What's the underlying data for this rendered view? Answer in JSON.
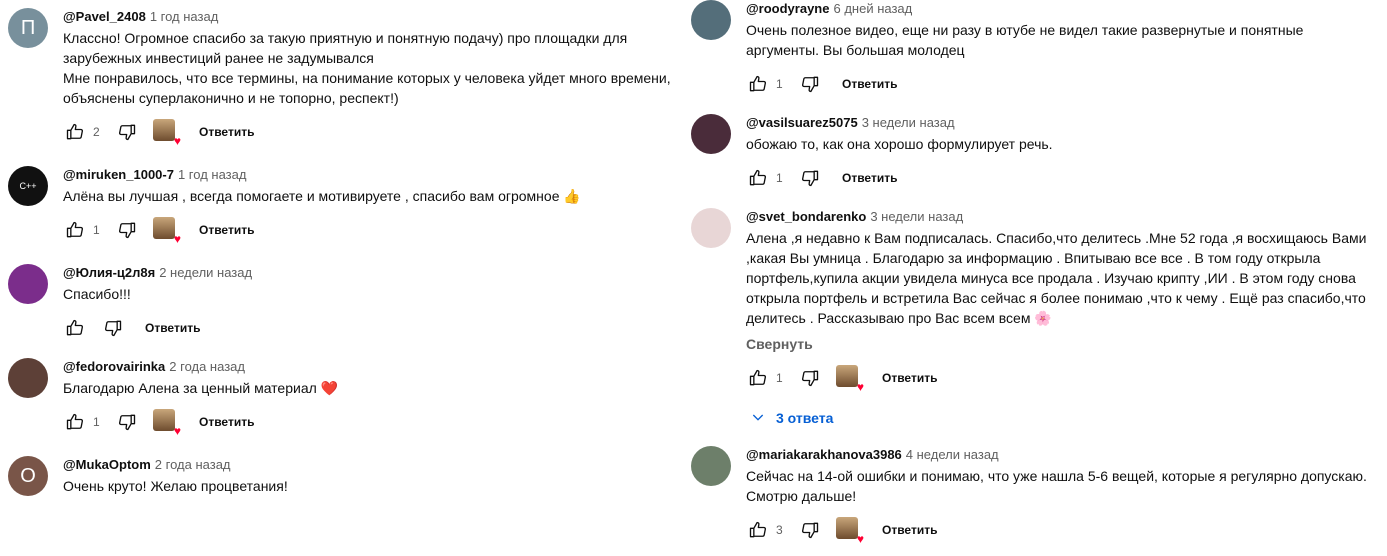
{
  "left": [
    {
      "author": "@Pavel_2408",
      "time": "1 год назад",
      "avatar_letter": "П",
      "avatar_color": "#78909c",
      "text": [
        "Классно! Огромное спасибо за такую приятную и понятную подачу) про площадки для",
        "зарубежных инвестиций ранее не задумывался",
        "Мне понравилось, что все термины, на понимание которых у человека уйдет много времени,",
        "объяснены суперлаконично и не топорно, респект!)"
      ],
      "likes": "2",
      "reply_label": "Ответить",
      "hearted": true
    },
    {
      "author": "@miruken_1000-7",
      "time": "1 год назад",
      "avatar_letter": "C++",
      "avatar_color": "#111111",
      "text": [
        "Алёна  вы лучшая , всегда помогаете и мотивируете , спасибо вам огромное"
      ],
      "emoji": "👍",
      "likes": "1",
      "reply_label": "Ответить",
      "hearted": true
    },
    {
      "author": "@Юлия-ц2л8я",
      "time": "2 недели назад",
      "avatar_color": "#7b2d8b",
      "text": [
        "Спасибо!!!"
      ],
      "likes": "",
      "reply_label": "Ответить",
      "hearted": false
    },
    {
      "author": "@fedorovairinka",
      "time": "2 года назад",
      "avatar_color": "#5d4037",
      "text": [
        "Благодарю Алена за ценный материал"
      ],
      "emoji": "❤️",
      "likes": "1",
      "reply_label": "Ответить",
      "hearted": true
    },
    {
      "author": "@MukaOptom",
      "time": "2 года назад",
      "avatar_letter": "О",
      "avatar_color": "#795548",
      "text": [
        "Очень круто! Желаю процветания!"
      ]
    }
  ],
  "right": [
    {
      "author": "@roodyrayne",
      "time": "6 дней назад",
      "avatar_color": "#546e7a",
      "text": [
        "Очень полезное видео, еще ни разу в ютубе не видел такие развернутые и понятные",
        "аргументы. Вы большая молодец"
      ],
      "likes": "1",
      "reply_label": "Ответить",
      "hearted": false
    },
    {
      "author": "@vasilsuarez5075",
      "time": "3 недели назад",
      "avatar_color": "#4a2c3a",
      "text": [
        "обожаю то, как она хорошо формулирует речь."
      ],
      "likes": "1",
      "reply_label": "Ответить",
      "hearted": false
    },
    {
      "author": "@svet_bondarenko",
      "time": "3 недели назад",
      "avatar_color": "#e8d6d6",
      "text": [
        "Алена ,я недавно к Вам подписалась. Спасибо,что делитесь .Мне 52 года ,я восхищаюсь Вами",
        ",какая Вы умница . Благодарю за информацию . Впитываю все все . В том году открыла",
        "портфель,купила акции увидела минуса все продала . Изучаю крипту ,ИИ . В этом году снова",
        "открыла портфель и встретила Вас сейчас я более понимаю ,что к чему . Ещё раз спасибо,что",
        "делитесь . Рассказываю про Вас всем всем"
      ],
      "emoji": "🌸",
      "collapse_label": "Свернуть",
      "likes": "1",
      "reply_label": "Ответить",
      "hearted": true,
      "replies_label": "3 ответа"
    },
    {
      "author": "@mariakarakhanova3986",
      "time": "4 недели назад",
      "avatar_color": "#6d7f6a",
      "text": [
        "Сейчас на 14-ой ошибки и понимаю, что уже нашла 5-6 вещей, которые я регулярно допускаю.",
        "Смотрю дальше!"
      ],
      "likes": "3",
      "reply_label": "Ответить",
      "hearted": true
    }
  ]
}
